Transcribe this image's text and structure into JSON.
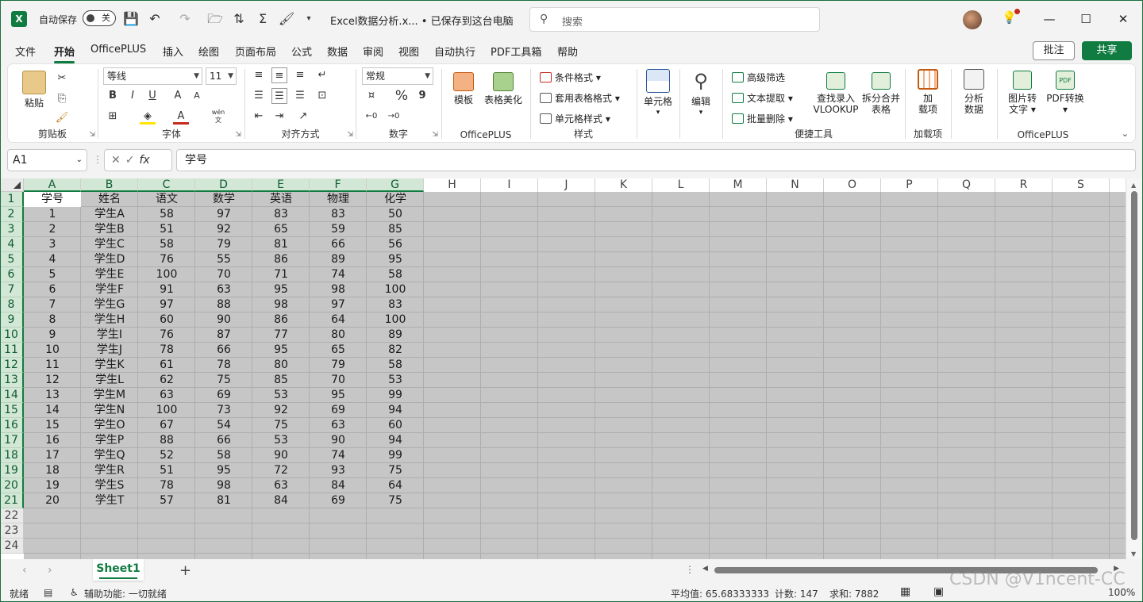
{
  "titlebar": {
    "autosave_label": "自动保存",
    "autosave_state": "关",
    "doc_title": "Excel数据分析.x... • 已保存到这台电脑",
    "search_placeholder": "搜索"
  },
  "menu": [
    "文件",
    "开始",
    "OfficePLUS",
    "插入",
    "绘图",
    "页面布局",
    "公式",
    "数据",
    "审阅",
    "视图",
    "自动执行",
    "PDF工具箱",
    "帮助"
  ],
  "menu_active": "开始",
  "actions": {
    "comment": "批注",
    "share": "共享"
  },
  "ribbon": {
    "clipboard": {
      "paste": "粘贴",
      "label": "剪贴板"
    },
    "font": {
      "name": "等线",
      "size": "11",
      "label": "字体",
      "bold": "B",
      "italic": "I",
      "underline": "U",
      "grow": "A",
      "shrink": "A",
      "color": "A",
      "wen": "wén 文"
    },
    "align": {
      "label": "对齐方式"
    },
    "number": {
      "format": "常规",
      "label": "数字",
      "percent": "%",
      "comma": "9"
    },
    "officeplus1": {
      "template": "模板",
      "beautify": "表格美化",
      "label": "OfficePLUS"
    },
    "styles": {
      "cond": "条件格式",
      "table": "套用表格格式",
      "cell": "单元格样式",
      "label": "样式"
    },
    "cells": {
      "label": "单元格"
    },
    "edit": {
      "label": "编辑"
    },
    "tools": {
      "filter": "高级筛选",
      "extract": "文本提取",
      "delete": "批量删除",
      "vlookup1": "查找录入",
      "vlookup2": "VLOOKUP",
      "split1": "拆分合并",
      "split2": "表格",
      "label": "便捷工具"
    },
    "addins": {
      "btn1": "加",
      "btn2": "载项",
      "label": "加载项"
    },
    "analyze": {
      "btn1": "分析",
      "btn2": "数据"
    },
    "officeplus2": {
      "img1": "图片转",
      "img2": "文字",
      "pdf": "PDF转换",
      "label": "OfficePLUS"
    }
  },
  "formula_bar": {
    "name_box": "A1",
    "fx": "fx",
    "content": "学号"
  },
  "columns": [
    "A",
    "B",
    "C",
    "D",
    "E",
    "F",
    "G",
    "H",
    "I",
    "J",
    "K",
    "L",
    "M",
    "N",
    "O",
    "P",
    "Q",
    "R",
    "S"
  ],
  "rows": [
    "1",
    "2",
    "3",
    "4",
    "5",
    "6",
    "7",
    "8",
    "9",
    "10",
    "11",
    "12",
    "13",
    "14",
    "15",
    "16",
    "17",
    "18",
    "19",
    "20",
    "21",
    "22",
    "23",
    "24"
  ],
  "table": {
    "header": [
      "学号",
      "姓名",
      "语文",
      "数学",
      "英语",
      "物理",
      "化学"
    ],
    "data": [
      [
        "1",
        "学生A",
        "58",
        "97",
        "83",
        "83",
        "50"
      ],
      [
        "2",
        "学生B",
        "51",
        "92",
        "65",
        "59",
        "85"
      ],
      [
        "3",
        "学生C",
        "58",
        "79",
        "81",
        "66",
        "56"
      ],
      [
        "4",
        "学生D",
        "76",
        "55",
        "86",
        "89",
        "95"
      ],
      [
        "5",
        "学生E",
        "100",
        "70",
        "71",
        "74",
        "58"
      ],
      [
        "6",
        "学生F",
        "91",
        "63",
        "95",
        "98",
        "100"
      ],
      [
        "7",
        "学生G",
        "97",
        "88",
        "98",
        "97",
        "83"
      ],
      [
        "8",
        "学生H",
        "60",
        "90",
        "86",
        "64",
        "100"
      ],
      [
        "9",
        "学生I",
        "76",
        "87",
        "77",
        "80",
        "89"
      ],
      [
        "10",
        "学生J",
        "78",
        "66",
        "95",
        "65",
        "82"
      ],
      [
        "11",
        "学生K",
        "61",
        "78",
        "80",
        "79",
        "58"
      ],
      [
        "12",
        "学生L",
        "62",
        "75",
        "85",
        "70",
        "53"
      ],
      [
        "13",
        "学生M",
        "63",
        "69",
        "53",
        "95",
        "99"
      ],
      [
        "14",
        "学生N",
        "100",
        "73",
        "92",
        "69",
        "94"
      ],
      [
        "15",
        "学生O",
        "67",
        "54",
        "75",
        "63",
        "60"
      ],
      [
        "16",
        "学生P",
        "88",
        "66",
        "53",
        "90",
        "94"
      ],
      [
        "17",
        "学生Q",
        "52",
        "58",
        "90",
        "74",
        "99"
      ],
      [
        "18",
        "学生R",
        "51",
        "95",
        "72",
        "93",
        "75"
      ],
      [
        "19",
        "学生S",
        "78",
        "98",
        "63",
        "84",
        "64"
      ],
      [
        "20",
        "学生T",
        "57",
        "81",
        "84",
        "69",
        "75"
      ]
    ]
  },
  "sheet_tabs": [
    "Sheet1"
  ],
  "status": {
    "ready": "就绪",
    "accessibility": "辅助功能: 一切就绪",
    "average": "平均值: 65.68333333",
    "count": "计数: 147",
    "sum": "求和: 7882",
    "zoom": "100%"
  },
  "watermark": "CSDN @V1ncent-CC",
  "colors": {
    "accent": "#107c41",
    "selection_bg": "#c6c6c6"
  }
}
